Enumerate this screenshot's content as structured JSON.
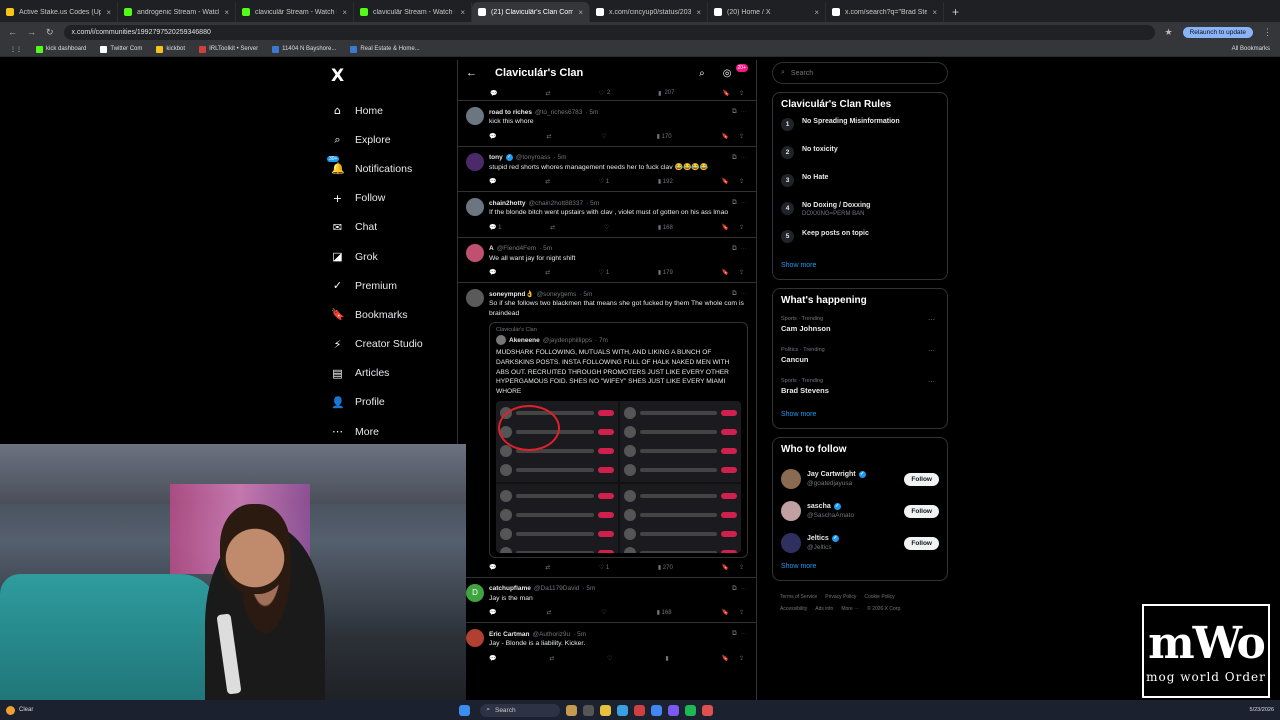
{
  "browser": {
    "tabs": [
      {
        "title": "Active Stake.us Codes (Updated)",
        "color": "#f5c518"
      },
      {
        "title": "androgenic Stream - Watch Live",
        "color": "#53fc18"
      },
      {
        "title": "claviculär Stream - Watch Live",
        "color": "#53fc18"
      },
      {
        "title": "claviculär Stream - Watch Live",
        "color": "#53fc18"
      },
      {
        "title": "(21) Claviculär's Clan Community",
        "color": "#ffffff"
      },
      {
        "title": "x.com/cincyup0/status/20366",
        "color": "#ffffff"
      },
      {
        "title": "(20) Home / X",
        "color": "#ffffff"
      },
      {
        "title": "x.com/search?q=\"Brad Stevens\"",
        "color": "#ffffff"
      }
    ],
    "url": "x.com/i/communities/1992797520259346880",
    "relaunch": "Relaunch to update",
    "bookmarks": [
      "kick dashboard",
      "Twitter Com",
      "kickbot",
      "IRLToolkit • Server",
      "11404 N Bayshore...",
      "Real Estate & Home..."
    ],
    "all_bookmarks": "All Bookmarks"
  },
  "nav": {
    "logo": "X",
    "badge": "30+",
    "items": [
      {
        "label": "Home",
        "icon": "⌂"
      },
      {
        "label": "Explore",
        "icon": "⌕"
      },
      {
        "label": "Notifications",
        "icon": "🔔"
      },
      {
        "label": "Follow",
        "icon": "+"
      },
      {
        "label": "Chat",
        "icon": "✉"
      },
      {
        "label": "Grok",
        "icon": "◪"
      },
      {
        "label": "Premium",
        "icon": "✓"
      },
      {
        "label": "Bookmarks",
        "icon": "🔖"
      },
      {
        "label": "Creator Studio",
        "icon": "⚡"
      },
      {
        "label": "Articles",
        "icon": "▤"
      },
      {
        "label": "Profile",
        "icon": "👤"
      },
      {
        "label": "More",
        "icon": "⋯"
      }
    ]
  },
  "community": {
    "title": "Claviculár's Clan",
    "badge": "20+",
    "top_actions": {
      "likes": "2",
      "views": "207"
    },
    "posts": [
      {
        "name": "road to riches",
        "handle": "@to_riches6783",
        "time": "· 5m",
        "text": "kick this whore",
        "verified": false,
        "reposts": "",
        "likes": "",
        "views": "170",
        "avatar": "#6b7680",
        "initial": ""
      },
      {
        "name": "tony",
        "handle": "@tonyroass",
        "time": "· 5m",
        "text": "stupid red shorts whores management needs her to fuck clav 😂😂😂😂",
        "verified": true,
        "reposts": "",
        "likes": "1",
        "views": "192",
        "avatar": "#4a2a6a",
        "initial": ""
      },
      {
        "name": "chain2hotty",
        "handle": "@chain2hott88337",
        "time": "· 5m",
        "text": "If the blonde bitch went upstairs with clav , violet must of gotten on his ass lmao",
        "verified": false,
        "reposts": "",
        "likes": "",
        "views": "168",
        "avatar": "#6b7680",
        "initial": "",
        "replies": "1"
      },
      {
        "name": "A",
        "handle": "@Flend4Fem",
        "time": "· 5m",
        "text": "We all want jay for night shift",
        "verified": false,
        "reposts": "",
        "likes": "1",
        "views": "179",
        "avatar": "#c05070",
        "initial": ""
      },
      {
        "name": "soneympnd👌",
        "handle": "@soneygems",
        "time": "· 5m",
        "text": "So if she follows two blackmen that means she got fucked by them The whole com is braindead",
        "verified": false,
        "reposts": "",
        "likes": "1",
        "views": "270",
        "avatar": "#5a5a5a",
        "initial": ""
      },
      {
        "name": "catchupflame",
        "handle": "@Da1179David",
        "time": "· 5m",
        "text": "Jay is the man",
        "verified": false,
        "reposts": "",
        "likes": "",
        "views": "168",
        "avatar": "#3fa33f",
        "initial": "D"
      },
      {
        "name": "Eric Cartman",
        "handle": "@Authoriz9u",
        "time": "· 5m",
        "text": "Jay - Blonde is a liability. Kicker.",
        "verified": false,
        "reposts": "",
        "likes": "",
        "views": "",
        "avatar": "#b04030",
        "initial": ""
      }
    ],
    "quote": {
      "community": "Claviculár's Clan",
      "name": "Akeneene",
      "handle": "@jaydenphillipps",
      "time": "· 7m",
      "text": "MUDSHARK FOLLOWING, MUTUALS WITH, AND LIKING A BUNCH OF DARKSKINS POSTS. INSTA FOLLOWING FULL OF HALK NAKED MEN WITH ABS OUT. RECRUITED THROUGH PROMOTERS JUST LIKE EVERY OTHER HYPERGAMOUS FOID. SHES NO \"WIFEY\" SHES JUST LIKE EVERY MIAMI WHORE"
    }
  },
  "sidebar": {
    "search_placeholder": "Search",
    "rules_title": "Claviculár's Clan Rules",
    "rules": [
      {
        "num": "1",
        "text": "No Spreading Misinformation",
        "sub": ""
      },
      {
        "num": "2",
        "text": "No toxicity",
        "sub": ""
      },
      {
        "num": "3",
        "text": "No Hate",
        "sub": ""
      },
      {
        "num": "4",
        "text": "No Doxing / Doxxing",
        "sub": "DOXXING=PERM BAN"
      },
      {
        "num": "5",
        "text": "Keep posts on topic",
        "sub": ""
      }
    ],
    "show_more": "Show more",
    "happening_title": "What's happening",
    "trends": [
      {
        "meta": "Sports · Trending",
        "name": "Cam Johnson"
      },
      {
        "meta": "Politics · Trending",
        "name": "Cancun"
      },
      {
        "meta": "Sports · Trending",
        "name": "Brad Stevens"
      }
    ],
    "wtf_title": "Who to follow",
    "follow_label": "Follow",
    "who_to_follow": [
      {
        "name": "Jay Cartwright",
        "handle": "@goatedjayusa",
        "color": "#8a6a50"
      },
      {
        "name": "sascha",
        "handle": "@SaschaAmato",
        "color": "#c0a0a0"
      },
      {
        "name": "Jeltics",
        "handle": "@Jeltics",
        "color": "#303060"
      }
    ],
    "footer": [
      "Terms of Service",
      "Privacy Policy",
      "Cookie Policy",
      "Accessibility",
      "Ads info",
      "More ···",
      "© 2026 X Corp."
    ]
  },
  "overlay": {
    "logo_big": "mWo",
    "logo_small": "mog world Order"
  },
  "taskbar": {
    "weather": "Clear",
    "search": "Search",
    "clock": "5/23/2026"
  },
  "colors": {
    "accent": "#1d9bf0",
    "pink": "#f91880"
  }
}
